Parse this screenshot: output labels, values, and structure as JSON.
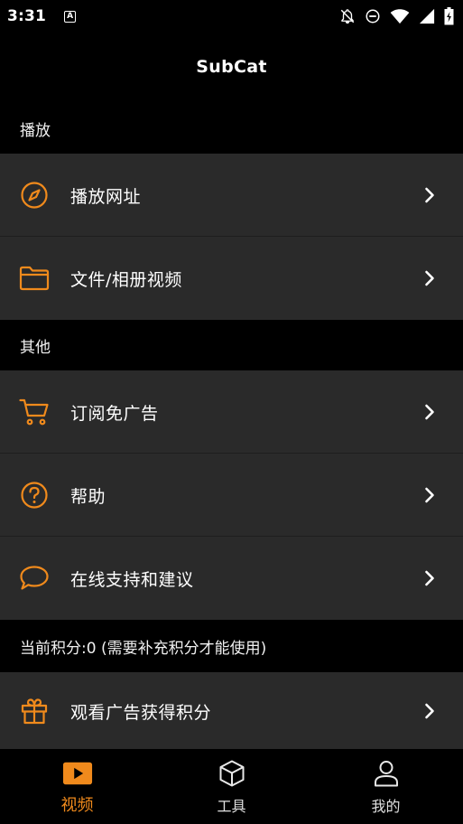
{
  "status_bar": {
    "time": "3:31",
    "notification_glyph": "A",
    "icons": [
      "notifications-off-icon",
      "do-not-disturb-icon",
      "wifi-icon",
      "signal-icon",
      "battery-charging-icon"
    ]
  },
  "app": {
    "title": "SubCat"
  },
  "accent_color": "#f08a1c",
  "sections": {
    "play": {
      "header": "播放",
      "items": [
        {
          "label": "播放网址",
          "icon": "compass-icon"
        },
        {
          "label": "文件/相册视频",
          "icon": "folder-icon"
        }
      ]
    },
    "other": {
      "header": "其他",
      "items": [
        {
          "label": "订阅免广告",
          "icon": "cart-icon"
        },
        {
          "label": "帮助",
          "icon": "help-circle-icon"
        },
        {
          "label": "在线支持和建议",
          "icon": "chat-bubble-icon"
        }
      ]
    },
    "points": {
      "header": "当前积分:0 (需要补充积分才能使用)",
      "items": [
        {
          "label": "观看广告获得积分",
          "icon": "gift-icon"
        }
      ]
    }
  },
  "bottom_nav": {
    "items": [
      {
        "label": "视频",
        "icon": "play-video-icon",
        "active": true
      },
      {
        "label": "工具",
        "icon": "cube-icon",
        "active": false
      },
      {
        "label": "我的",
        "icon": "person-icon",
        "active": false
      }
    ]
  }
}
